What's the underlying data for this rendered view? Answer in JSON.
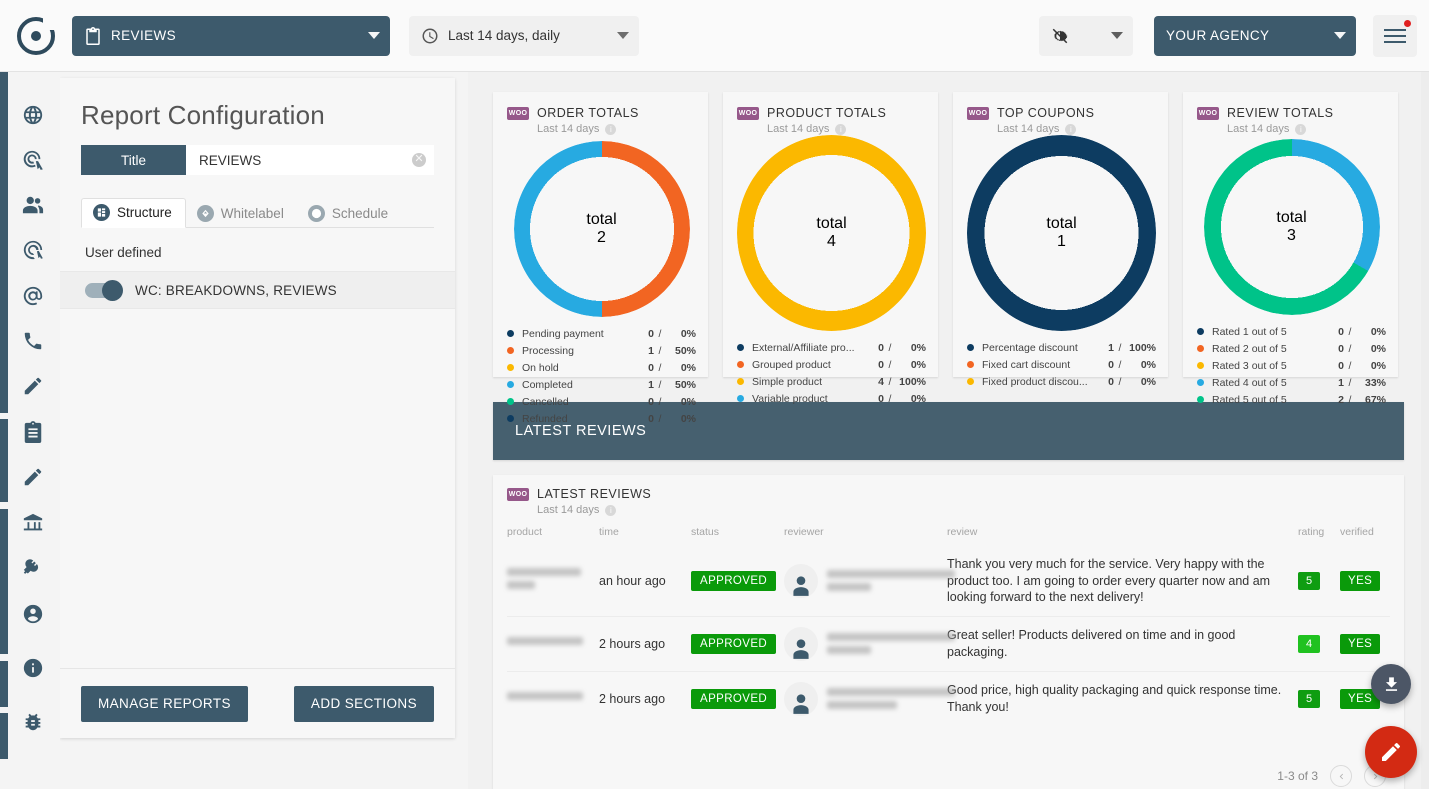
{
  "topbar": {
    "logo_name": "app-logo",
    "report_select": {
      "label": "REVIEWS",
      "icon": "clipboard-icon"
    },
    "date_select": {
      "label": "Last 14 days, daily",
      "icon": "clock-icon"
    },
    "theme_select": {
      "icon": "brightness-icon"
    },
    "agency_select": {
      "label": "YOUR AGENCY"
    },
    "menu_button": {
      "icon": "hamburger-icon",
      "badge": true
    }
  },
  "sidebar": {
    "items": [
      {
        "name": "sidebar-item-globe",
        "icon": "globe-icon"
      },
      {
        "name": "sidebar-item-seo",
        "icon": "target-tap-icon"
      },
      {
        "name": "sidebar-item-social",
        "icon": "people-icon"
      },
      {
        "name": "sidebar-item-ads",
        "icon": "click-target-icon"
      },
      {
        "name": "sidebar-item-email",
        "icon": "at-sign-icon"
      },
      {
        "name": "sidebar-item-calls",
        "icon": "phone-icon"
      },
      {
        "name": "sidebar-item-content",
        "icon": "pencil-icon"
      },
      {
        "name": "sidebar-item-reports",
        "icon": "clipboard-icon"
      },
      {
        "name": "sidebar-item-editor",
        "icon": "pencil-ruler-icon"
      },
      {
        "name": "sidebar-item-finance",
        "icon": "bank-icon"
      },
      {
        "name": "sidebar-item-integrations",
        "icon": "plug-icon"
      },
      {
        "name": "sidebar-item-account",
        "icon": "account-circle-icon"
      },
      {
        "name": "sidebar-item-info",
        "icon": "info-icon"
      },
      {
        "name": "sidebar-item-debug",
        "icon": "bug-icon"
      }
    ]
  },
  "panel": {
    "heading": "Report Configuration",
    "title_field": {
      "key_label": "Title",
      "value": "REVIEWS",
      "placeholder": "Title"
    },
    "tabs": [
      {
        "label": "Structure",
        "icon": "structure-icon",
        "active": true
      },
      {
        "label": "Whitelabel",
        "icon": "whitelabel-icon",
        "active": false
      },
      {
        "label": "Schedule",
        "icon": "schedule-icon",
        "active": false
      }
    ],
    "section_label": "User defined",
    "toggle_item": {
      "label": "WC: BREAKDOWNS, REVIEWS",
      "on": true
    },
    "buttons": {
      "manage": "MANAGE REPORTS",
      "add": "ADD SECTIONS"
    }
  },
  "colors": {
    "navy": "#0d3c61",
    "orange": "#f26522",
    "yellow": "#fbb800",
    "cyan": "#27aae1",
    "green": "#00c389",
    "dark_slate": "#3d5a6c",
    "banner": "#46606f",
    "approved_green": "#0a9a0a",
    "rating_green_5": "#0f9d11",
    "rating_green_4": "#20c220",
    "fab_red": "#d32a13",
    "fab_gray": "#4c5666",
    "woo_purple": "#96588a"
  },
  "chart_data": [
    {
      "type": "pie",
      "title": "ORDER TOTALS",
      "subtitle": "Last 14 days",
      "center_label": "total",
      "center_value": "2",
      "source_badge": "WOO",
      "categories": [
        "Pending payment",
        "Processing",
        "On hold",
        "Completed",
        "Cancelled",
        "Refunded"
      ],
      "values": [
        0,
        1,
        0,
        1,
        0,
        0
      ],
      "percents": [
        "0%",
        "50%",
        "0%",
        "50%",
        "0%",
        "0%"
      ],
      "colors": [
        "#0d3c61",
        "#f26522",
        "#fbb800",
        "#27aae1",
        "#00c389",
        "#0d3c61"
      ],
      "legend": "bottom"
    },
    {
      "type": "pie",
      "title": "PRODUCT TOTALS",
      "subtitle": "Last 14 days",
      "center_label": "total",
      "center_value": "4",
      "source_badge": "WOO",
      "categories": [
        "External/Affiliate pro...",
        "Grouped product",
        "Simple product",
        "Variable product"
      ],
      "values": [
        0,
        0,
        4,
        0
      ],
      "percents": [
        "0%",
        "0%",
        "100%",
        "0%"
      ],
      "colors": [
        "#0d3c61",
        "#f26522",
        "#fbb800",
        "#27aae1"
      ],
      "legend": "bottom"
    },
    {
      "type": "pie",
      "title": "TOP COUPONS",
      "subtitle": "Last 14 days",
      "center_label": "total",
      "center_value": "1",
      "source_badge": "WOO",
      "categories": [
        "Percentage discount",
        "Fixed cart discount",
        "Fixed product discou..."
      ],
      "values": [
        1,
        0,
        0
      ],
      "percents": [
        "100%",
        "0%",
        "0%"
      ],
      "colors": [
        "#0d3c61",
        "#f26522",
        "#fbb800"
      ],
      "legend": "bottom"
    },
    {
      "type": "pie",
      "title": "REVIEW TOTALS",
      "subtitle": "Last 14 days",
      "center_label": "total",
      "center_value": "3",
      "source_badge": "WOO",
      "categories": [
        "Rated 1 out of 5",
        "Rated 2 out of 5",
        "Rated 3 out of 5",
        "Rated 4 out of 5",
        "Rated 5 out of 5"
      ],
      "values": [
        0,
        0,
        0,
        1,
        2
      ],
      "percents": [
        "0%",
        "0%",
        "0%",
        "33%",
        "67%"
      ],
      "colors": [
        "#0d3c61",
        "#f26522",
        "#fbb800",
        "#27aae1",
        "#00c389"
      ],
      "legend": "bottom"
    }
  ],
  "banner": {
    "label": "LATEST REVIEWS"
  },
  "reviews_table": {
    "title": "LATEST REVIEWS",
    "subtitle": "Last 14 days",
    "source_badge": "WOO",
    "columns": [
      "product",
      "time",
      "status",
      "reviewer",
      "review",
      "rating",
      "verified"
    ],
    "rows": [
      {
        "product": "",
        "time": "an hour ago",
        "status": "APPROVED",
        "reviewer_name": "",
        "reviewer_email": "",
        "review": "Thank you very much for the service. Very happy with the product too. I am going to order every quarter now and am looking forward to the next delivery!",
        "rating": "5",
        "verified": "YES"
      },
      {
        "product": "",
        "time": "2 hours ago",
        "status": "APPROVED",
        "reviewer_name": "",
        "reviewer_email": "",
        "review": "Great seller! Products delivered on time and in good packaging.",
        "rating": "4",
        "verified": "YES"
      },
      {
        "product": "",
        "time": "2 hours ago",
        "status": "APPROVED",
        "reviewer_name": "",
        "reviewer_email": "",
        "review": "Good price, high quality packaging and quick response time. Thank you!",
        "rating": "5",
        "verified": "YES"
      }
    ],
    "pagination": {
      "range": "1-3 of 3",
      "prev_icon": "chevron-left-icon",
      "next_icon": "chevron-right-icon"
    }
  },
  "fabs": {
    "download": "download-icon",
    "edit": "pencil-icon"
  }
}
